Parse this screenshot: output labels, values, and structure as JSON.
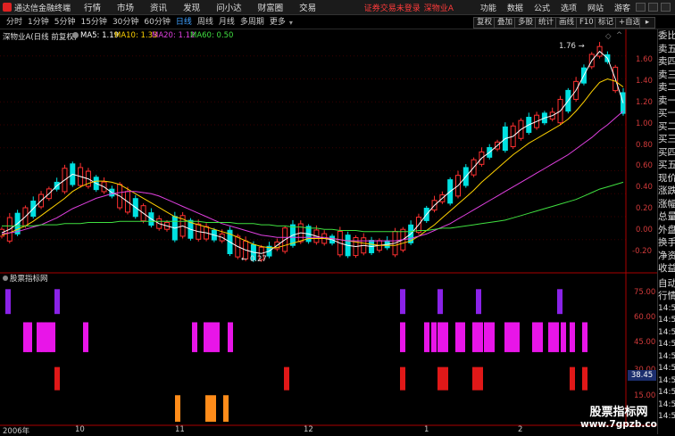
{
  "menubar": {
    "brand": "通达信金融终端",
    "items": [
      "行情",
      "市场",
      "资讯",
      "发现",
      "问小达",
      "财富圈",
      "交易"
    ],
    "warning": "证券交易未登录",
    "stock": "深物业A",
    "right": [
      "功能",
      "数据",
      "公式",
      "选项",
      "网站",
      "游客"
    ]
  },
  "toolbar": {
    "periods": [
      "分时",
      "1分钟",
      "5分钟",
      "15分钟",
      "30分钟",
      "60分钟",
      "日线",
      "周线",
      "月线",
      "多周期",
      "更多"
    ],
    "active": "日线",
    "right": [
      "复权",
      "叠加",
      "多股",
      "统计",
      "画线",
      "F10",
      "标记",
      "+自选"
    ]
  },
  "chart_header": {
    "title": "深物业A(日线 前复权)",
    "ma": [
      {
        "label": "MA5: 1.19",
        "color": "#ffffff"
      },
      {
        "label": "MA10: 1.33",
        "color": "#ffd200"
      },
      {
        "label": "MA20: 1.12",
        "color": "#e040e0"
      },
      {
        "label": "MA60: 0.50",
        "color": "#40e040"
      }
    ]
  },
  "annotations": {
    "high": "1.76",
    "low": "0.27"
  },
  "price_axis": [
    "1.60",
    "1.40",
    "1.20",
    "1.00",
    "0.80",
    "0.60",
    "0.40",
    "0.20",
    "0.00",
    "-0.20"
  ],
  "indicator": {
    "title": "股票指标网",
    "axis": [
      "75.00",
      "60.00",
      "45.00",
      "30.00",
      "15.00"
    ],
    "value_box": "38.45"
  },
  "date_axis": [
    "2006年",
    "10",
    "11",
    "12",
    "1",
    "2"
  ],
  "sidebar": [
    "委比",
    "卖五",
    "卖四",
    "卖三",
    "卖二",
    "卖一",
    "买一",
    "买二",
    "买三",
    "买四",
    "买五",
    "现价",
    "涨跌",
    "涨幅",
    "总量",
    "外盘",
    "换手",
    "净资",
    "收益",
    "自动",
    "行情"
  ],
  "sidebar_times": [
    "14:50",
    "14:50",
    "14:50",
    "14:50",
    "14:50",
    "14:50",
    "14:50",
    "14:50",
    "14:50",
    "14:50"
  ],
  "watermark": {
    "line1": "股票指标网",
    "line2": "www.7gpzb.com"
  },
  "chart_data": [
    {
      "type": "candlestick",
      "title": "深物业A(日线 前复权)",
      "ylim": [
        -0.25,
        1.8
      ],
      "series": [
        {
          "name": "MA5",
          "values": [
            0.06,
            0.09,
            0.14,
            0.2,
            0.27,
            0.34,
            0.4,
            0.47,
            0.52,
            0.57,
            0.55,
            0.53,
            0.49,
            0.46,
            0.41,
            0.38,
            0.33,
            0.28,
            0.23,
            0.18,
            0.14,
            0.12,
            0.1,
            0.12,
            0.09,
            0.07,
            0.06,
            0.04,
            0.02,
            -0.02,
            -0.06,
            -0.09,
            -0.11,
            -0.12,
            -0.1,
            -0.05,
            0.0,
            0.04,
            0.06,
            0.05,
            0.03,
            0.01,
            0.0,
            -0.03,
            -0.05,
            -0.06,
            -0.05,
            -0.06,
            -0.05,
            -0.04,
            -0.03,
            0.0,
            0.05,
            0.13,
            0.22,
            0.3,
            0.36,
            0.42,
            0.47,
            0.55,
            0.63,
            0.71,
            0.76,
            0.82,
            0.88,
            0.9,
            0.96,
            1.0,
            1.03,
            1.06,
            1.08,
            1.12,
            1.21,
            1.3,
            1.43,
            1.56,
            1.64,
            1.58,
            1.4,
            1.19
          ]
        },
        {
          "name": "MA10",
          "values": [
            0.04,
            0.06,
            0.09,
            0.12,
            0.16,
            0.21,
            0.26,
            0.31,
            0.36,
            0.42,
            0.46,
            0.49,
            0.51,
            0.51,
            0.5,
            0.48,
            0.44,
            0.4,
            0.36,
            0.32,
            0.28,
            0.24,
            0.2,
            0.18,
            0.15,
            0.13,
            0.11,
            0.09,
            0.07,
            0.05,
            0.02,
            -0.01,
            -0.04,
            -0.06,
            -0.07,
            -0.07,
            -0.05,
            -0.03,
            -0.01,
            0.01,
            0.01,
            0.01,
            0.01,
            0.0,
            -0.01,
            -0.02,
            -0.03,
            -0.04,
            -0.05,
            -0.05,
            -0.05,
            -0.03,
            -0.01,
            0.03,
            0.08,
            0.13,
            0.19,
            0.25,
            0.31,
            0.37,
            0.43,
            0.5,
            0.56,
            0.62,
            0.68,
            0.74,
            0.79,
            0.84,
            0.88,
            0.92,
            0.96,
            1.0,
            1.05,
            1.12,
            1.2,
            1.29,
            1.37,
            1.4,
            1.38,
            1.33
          ]
        },
        {
          "name": "MA20",
          "values": [
            0.05,
            0.06,
            0.07,
            0.09,
            0.11,
            0.13,
            0.16,
            0.19,
            0.23,
            0.27,
            0.3,
            0.33,
            0.36,
            0.38,
            0.4,
            0.41,
            0.42,
            0.42,
            0.41,
            0.4,
            0.38,
            0.35,
            0.32,
            0.29,
            0.26,
            0.23,
            0.2,
            0.17,
            0.14,
            0.12,
            0.1,
            0.08,
            0.06,
            0.04,
            0.03,
            0.02,
            0.02,
            0.02,
            0.02,
            0.02,
            0.02,
            0.02,
            0.01,
            0.0,
            -0.01,
            -0.01,
            -0.01,
            -0.01,
            -0.01,
            -0.01,
            -0.01,
            0.0,
            0.01,
            0.03,
            0.05,
            0.08,
            0.11,
            0.14,
            0.18,
            0.22,
            0.26,
            0.3,
            0.34,
            0.38,
            0.42,
            0.46,
            0.5,
            0.54,
            0.58,
            0.62,
            0.66,
            0.7,
            0.74,
            0.79,
            0.84,
            0.89,
            0.95,
            1.0,
            1.06,
            1.12
          ]
        },
        {
          "name": "MA60",
          "values": [
            0.12,
            0.12,
            0.12,
            0.12,
            0.12,
            0.13,
            0.13,
            0.13,
            0.14,
            0.14,
            0.14,
            0.15,
            0.15,
            0.15,
            0.15,
            0.16,
            0.16,
            0.16,
            0.16,
            0.16,
            0.16,
            0.16,
            0.16,
            0.16,
            0.16,
            0.16,
            0.15,
            0.15,
            0.15,
            0.15,
            0.14,
            0.14,
            0.14,
            0.13,
            0.13,
            0.12,
            0.12,
            0.11,
            0.11,
            0.1,
            0.1,
            0.09,
            0.09,
            0.08,
            0.08,
            0.08,
            0.07,
            0.07,
            0.07,
            0.07,
            0.07,
            0.07,
            0.07,
            0.08,
            0.08,
            0.09,
            0.1,
            0.1,
            0.11,
            0.12,
            0.13,
            0.14,
            0.15,
            0.16,
            0.17,
            0.19,
            0.21,
            0.23,
            0.25,
            0.27,
            0.29,
            0.31,
            0.33,
            0.35,
            0.38,
            0.41,
            0.44,
            0.46,
            0.48,
            0.5
          ]
        }
      ]
    },
    {
      "type": "bar",
      "title": "股票指标网",
      "ylim": [
        0,
        85
      ],
      "series": [
        {
          "name": "violet",
          "color": "#8a22e8",
          "bars": [
            [
              6,
              65,
              80
            ],
            [
              61,
              65,
              80
            ],
            [
              448,
              65,
              80
            ],
            [
              490,
              65,
              80
            ],
            [
              533,
              65,
              80
            ],
            [
              624,
              65,
              80
            ]
          ]
        },
        {
          "name": "magenta",
          "color": "#e815e8",
          "bars": [
            [
              26,
              42,
              60
            ],
            [
              30,
              42,
              60
            ],
            [
              41,
              42,
              60
            ],
            [
              46,
              42,
              60
            ],
            [
              51,
              42,
              60
            ],
            [
              56,
              42,
              60
            ],
            [
              93,
              42,
              60
            ],
            [
              215,
              42,
              60
            ],
            [
              228,
              42,
              60
            ],
            [
              234,
              42,
              60
            ],
            [
              240,
              42,
              60
            ],
            [
              255,
              42,
              60
            ],
            [
              448,
              42,
              60
            ],
            [
              475,
              42,
              60
            ],
            [
              483,
              42,
              60
            ],
            [
              490,
              42,
              60
            ],
            [
              496,
              42,
              60
            ],
            [
              510,
              42,
              60
            ],
            [
              515,
              42,
              60
            ],
            [
              529,
              42,
              60
            ],
            [
              535,
              42,
              60
            ],
            [
              542,
              42,
              60
            ],
            [
              548,
              42,
              60
            ],
            [
              565,
              42,
              60
            ],
            [
              571,
              42,
              60
            ],
            [
              576,
              42,
              60
            ],
            [
              596,
              42,
              60
            ],
            [
              602,
              42,
              60
            ],
            [
              614,
              42,
              60
            ],
            [
              620,
              42,
              60
            ],
            [
              628,
              42,
              60
            ],
            [
              638,
              42,
              60
            ],
            [
              652,
              42,
              60
            ]
          ]
        },
        {
          "name": "red",
          "color": "#e01818",
          "bars": [
            [
              61,
              19,
              33
            ],
            [
              318,
              19,
              33
            ],
            [
              448,
              19,
              33
            ],
            [
              490,
              19,
              33
            ],
            [
              496,
              19,
              33
            ],
            [
              529,
              19,
              33
            ],
            [
              535,
              19,
              33
            ],
            [
              638,
              19,
              33
            ],
            [
              652,
              19,
              33
            ]
          ]
        },
        {
          "name": "orange",
          "color": "#ff8c1a",
          "bars": [
            [
              196,
              0,
              16
            ],
            [
              230,
              0,
              16
            ],
            [
              236,
              0,
              16
            ],
            [
              250,
              0,
              16
            ]
          ]
        }
      ]
    }
  ]
}
